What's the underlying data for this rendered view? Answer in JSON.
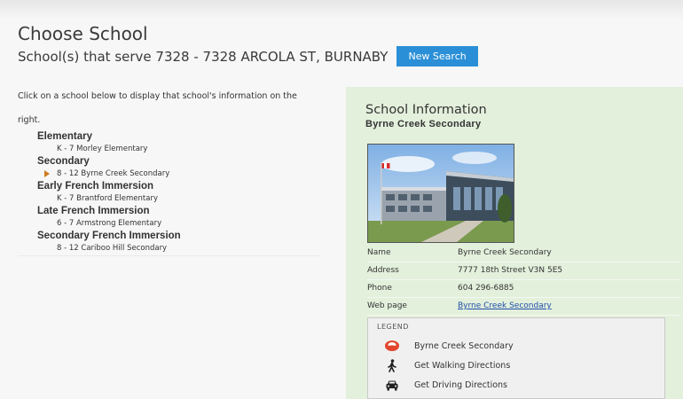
{
  "header": {
    "title": "Choose School",
    "serve_text": "School(s) that serve 7328 - 7328 ARCOLA ST, BURNABY",
    "new_search_label": "New Search"
  },
  "instructions": "Click on a school below to display that school's information on the right.",
  "categories": [
    {
      "label": "Elementary",
      "schools": [
        "K - 7 Morley Elementary"
      ]
    },
    {
      "label": "Secondary",
      "schools": [
        "8 - 12 Byrne Creek Secondary"
      ]
    },
    {
      "label": "Early French Immersion",
      "schools": [
        "K - 7 Brantford Elementary"
      ]
    },
    {
      "label": "Late French Immersion",
      "schools": [
        "6 - 7 Armstrong Elementary"
      ]
    },
    {
      "label": "Secondary French Immersion",
      "schools": [
        "8 - 12 Cariboo Hill Secondary"
      ]
    }
  ],
  "info": {
    "title": "School Information",
    "school_name": "Byrne Creek Secondary",
    "details": {
      "name_label": "Name",
      "name_value": "Byrne Creek Secondary",
      "address_label": "Address",
      "address_value": "7777 18th Street V3N 5E5",
      "phone_label": "Phone",
      "phone_value": "604 296-6885",
      "web_label": "Web page",
      "web_value": "Byrne Creek Secondary"
    },
    "legend": {
      "title": "LEGEND",
      "school_label": "Byrne Creek Secondary",
      "walking_label": "Get Walking Directions",
      "driving_label": "Get Driving Directions"
    }
  },
  "colors": {
    "accent_button": "#2a8fd6",
    "selected_arrow": "#d07a1e",
    "info_panel_bg": "#e3f0dc",
    "link": "#1f4fa8",
    "school_marker": "#e2452d"
  },
  "icons": {
    "selected_marker": "selected-arrow-icon",
    "school_marker": "school-marker-icon",
    "walking": "walking-person-icon",
    "driving": "car-icon"
  }
}
